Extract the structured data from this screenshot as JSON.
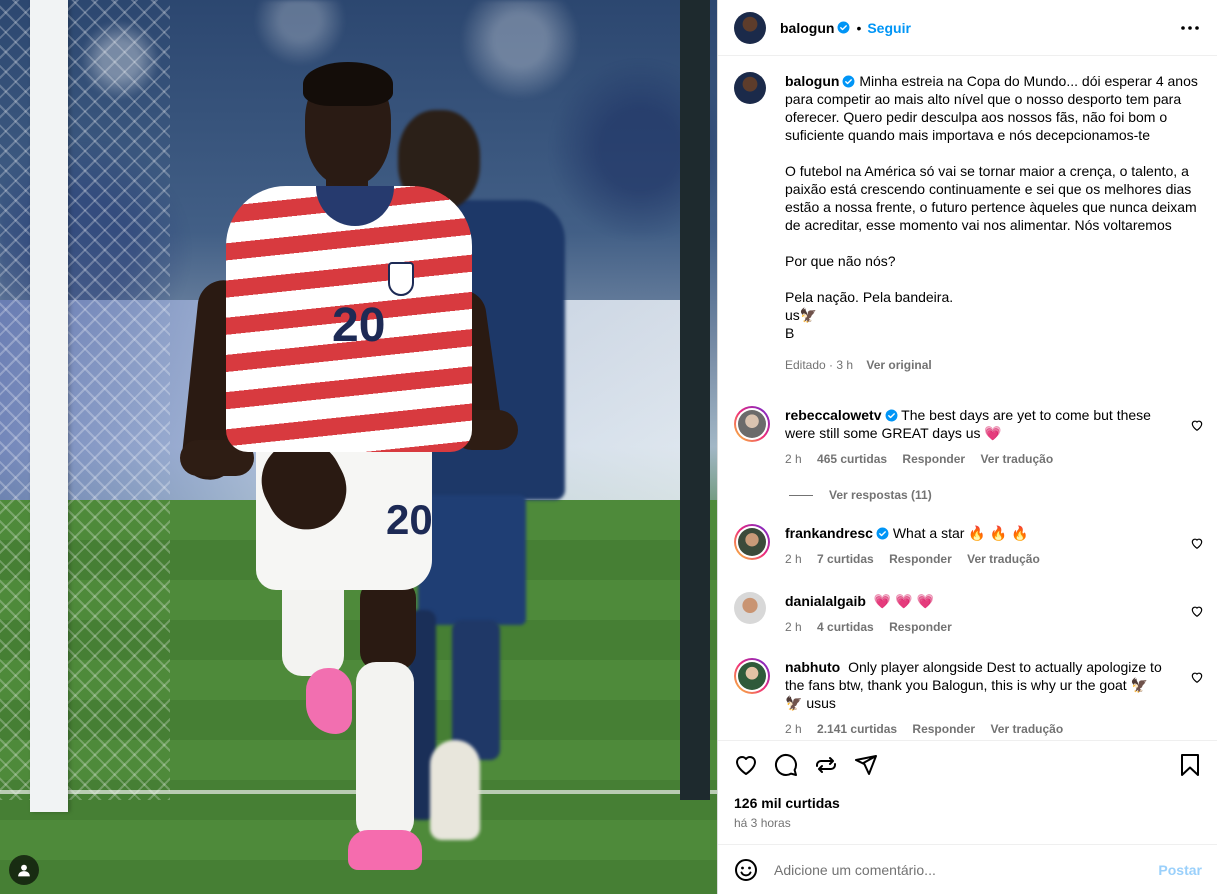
{
  "post": {
    "username": "balogun",
    "follow_label": "Seguir",
    "caption_lines": [
      "Minha estreia na Copa do Mundo... dói esperar 4 anos para competir ao mais alto nível que o nosso desporto tem para oferecer. Quero pedir desculpa aos nossos fãs, não foi bom o suficiente quando mais importava e nós decepcionamos-te",
      "O futebol na América só vai se tornar maior a crença, o talento, a paixão está crescendo continuamente e sei que os melhores dias estão a nossa frente, o futuro pertence àqueles que nunca deixam de acreditar, esse momento vai nos alimentar. Nós voltaremos",
      "Por que não nós?",
      "Pela nação. Pela bandeira.",
      "us🦅",
      "B"
    ],
    "caption_meta": "Editado · 3 h",
    "see_original": "Ver original",
    "likes": "126 mil curtidas",
    "time_ago": "há 3 horas"
  },
  "comments": [
    {
      "username": "rebeccalowetv",
      "verified": true,
      "text": "The best days are yet to come but these were still some GREAT days us 💗",
      "time": "2 h",
      "likes": "465 curtidas",
      "reply": "Responder",
      "translate": "Ver tradução",
      "view_replies": "Ver respostas (11)"
    },
    {
      "username": "frankandresc",
      "verified": true,
      "text": "What a star 🔥 🔥 🔥",
      "time": "2 h",
      "likes": "7 curtidas",
      "reply": "Responder",
      "translate": "Ver tradução"
    },
    {
      "username": "danialalgaib",
      "verified": false,
      "text": "💗 💗 💗",
      "time": "2 h",
      "likes": "4 curtidas",
      "reply": "Responder"
    },
    {
      "username": "nabhuto",
      "verified": false,
      "text": "Only player alongside Dest to actually apologize to the fans btw, thank you Balogun, this is why ur the goat 🦅 🦅 usus",
      "time": "2 h",
      "likes": "2.141 curtidas",
      "reply": "Responder",
      "translate": "Ver tradução"
    }
  ],
  "comment_box": {
    "placeholder": "Adicione um comentário...",
    "post_label": "Postar"
  },
  "photo": {
    "shirt_number": "20"
  },
  "icons": {
    "more": "more-options-icon",
    "like": "heart-icon",
    "comment": "comment-icon",
    "share": "share-icon",
    "send": "send-icon",
    "save": "bookmark-icon",
    "emoji": "emoji-icon",
    "user": "user-icon",
    "verified": "verified-badge-icon"
  },
  "colors": {
    "link": "#0095f6",
    "post_disabled": "#9ad0fb",
    "muted": "#737373"
  }
}
